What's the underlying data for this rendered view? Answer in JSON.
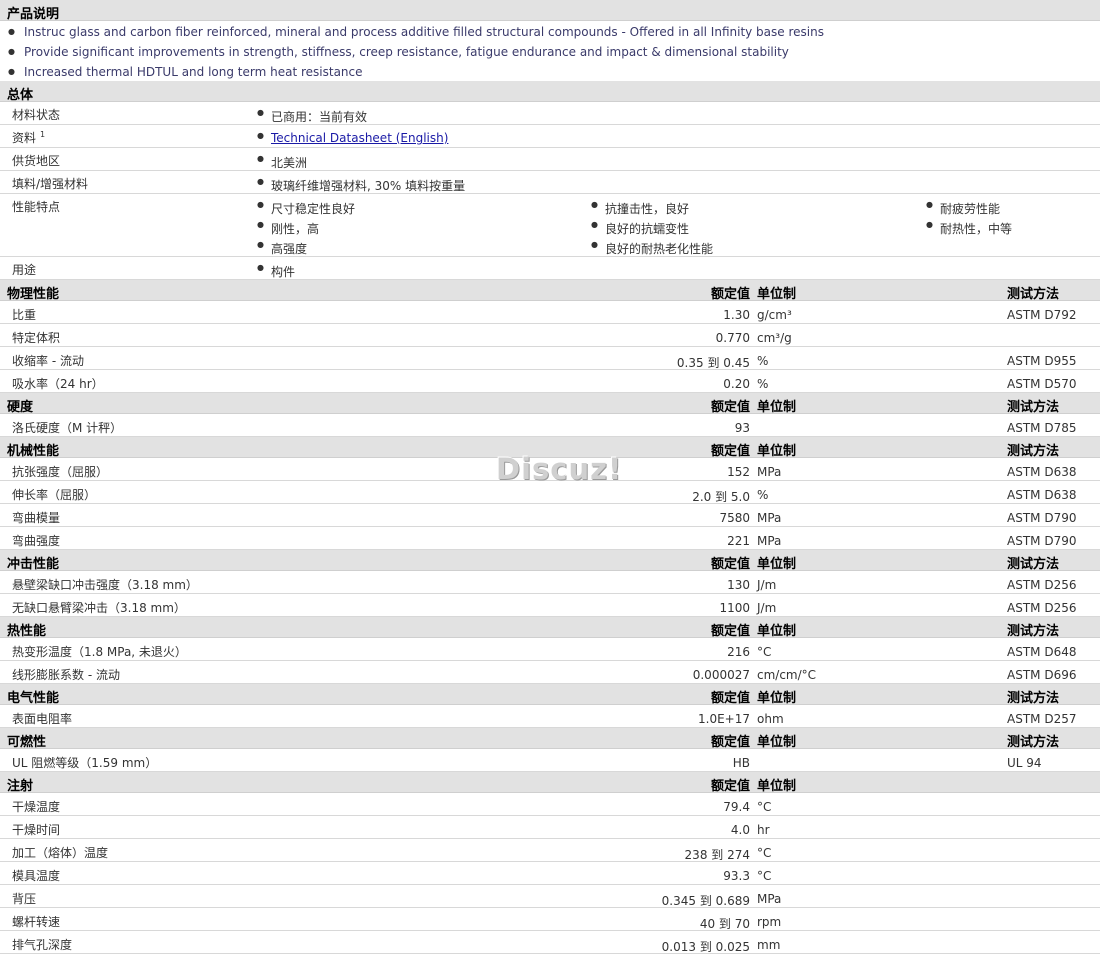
{
  "description": {
    "title": "产品说明",
    "bullets": [
      "Instruc glass and carbon fiber reinforced, mineral and process additive filled structural compounds - Offered in all Infinity base resins",
      "Provide significant improvements in strength, stiffness, creep resistance, fatigue endurance and impact & dimensional stability",
      "Increased thermal HDTUL and long term heat resistance"
    ]
  },
  "general": {
    "title": "总体",
    "rows": [
      {
        "label": "材料状态",
        "items": [
          "已商用：当前有效"
        ]
      },
      {
        "label": "资料",
        "sup": "1",
        "items": [
          "Technical Datasheet (English)"
        ],
        "link": true
      },
      {
        "label": "供货地区",
        "items": [
          "北美洲"
        ]
      },
      {
        "label": "填料/增强材料",
        "items": [
          "玻璃纤维增强材料, 30% 填料按重量"
        ]
      },
      {
        "label": "性能特点",
        "items": [
          "尺寸稳定性良好",
          "刚性，高",
          "高强度",
          "抗撞击性，良好",
          "良好的抗蠕变性",
          "良好的耐热老化性能",
          "耐疲劳性能",
          "耐热性，中等"
        ]
      },
      {
        "label": "用途",
        "items": [
          "构件"
        ]
      }
    ]
  },
  "headers": {
    "nominal": "额定值",
    "unit": "单位制",
    "method": "测试方法"
  },
  "sections": [
    {
      "title": "物理性能",
      "method_col": true,
      "rows": [
        {
          "label": "比重",
          "value": "1.30",
          "unit": "g/cm³",
          "method": "ASTM D792"
        },
        {
          "label": "特定体积",
          "value": "0.770",
          "unit": "cm³/g",
          "method": ""
        },
        {
          "label": "收缩率 - 流动",
          "value": "0.35 到  0.45",
          "unit": "%",
          "method": "ASTM D955"
        },
        {
          "label": "吸水率（24 hr）",
          "value": "0.20",
          "unit": "%",
          "method": "ASTM D570"
        }
      ]
    },
    {
      "title": "硬度",
      "method_col": true,
      "rows": [
        {
          "label": "洛氏硬度（M 计秤）",
          "value": "93",
          "unit": "",
          "method": "ASTM D785"
        }
      ]
    },
    {
      "title": "机械性能",
      "method_col": true,
      "rows": [
        {
          "label": "抗张强度（屈服）",
          "value": "152",
          "unit": "MPa",
          "method": "ASTM D638"
        },
        {
          "label": "伸长率（屈服）",
          "value": "2.0 到  5.0",
          "unit": "%",
          "method": "ASTM D638"
        },
        {
          "label": "弯曲模量",
          "value": "7580",
          "unit": "MPa",
          "method": "ASTM D790"
        },
        {
          "label": "弯曲强度",
          "value": "221",
          "unit": "MPa",
          "method": "ASTM D790"
        }
      ]
    },
    {
      "title": "冲击性能",
      "method_col": true,
      "rows": [
        {
          "label": "悬壁梁缺口冲击强度（3.18 mm）",
          "value": "130",
          "unit": "J/m",
          "method": "ASTM D256"
        },
        {
          "label": "无缺口悬臂梁冲击（3.18 mm）",
          "value": "1100",
          "unit": "J/m",
          "method": "ASTM D256"
        }
      ]
    },
    {
      "title": "热性能",
      "method_col": true,
      "rows": [
        {
          "label": "热变形温度（1.8 MPa, 未退火）",
          "value": "216",
          "unit": "°C",
          "method": "ASTM D648"
        },
        {
          "label": "线形膨胀系数 - 流动",
          "value": "0.000027",
          "unit": "cm/cm/°C",
          "method": "ASTM D696"
        }
      ]
    },
    {
      "title": "电气性能",
      "method_col": true,
      "rows": [
        {
          "label": "表面电阻率",
          "value": "1.0E+17",
          "unit": "ohm",
          "method": "ASTM D257"
        }
      ]
    },
    {
      "title": "可燃性",
      "method_col": true,
      "rows": [
        {
          "label": "UL 阻燃等级（1.59 mm）",
          "value": "HB",
          "unit": "",
          "method": "UL 94"
        }
      ]
    },
    {
      "title": "注射",
      "method_col": false,
      "rows": [
        {
          "label": "干燥温度",
          "value": "79.4",
          "unit": "°C",
          "method": ""
        },
        {
          "label": "干燥时间",
          "value": "4.0",
          "unit": "hr",
          "method": ""
        },
        {
          "label": "加工（熔体）温度",
          "value": "238 到  274",
          "unit": "°C",
          "method": ""
        },
        {
          "label": "模具温度",
          "value": "93.3",
          "unit": "°C",
          "method": ""
        },
        {
          "label": "背压",
          "value": "0.345 到  0.689",
          "unit": "MPa",
          "method": ""
        },
        {
          "label": "螺杆转速",
          "value": "40 到  70",
          "unit": "rpm",
          "method": ""
        },
        {
          "label": "排气孔深度",
          "value": "0.013 到  0.025",
          "unit": "mm",
          "method": ""
        }
      ]
    }
  ],
  "watermark": "Discuz!"
}
